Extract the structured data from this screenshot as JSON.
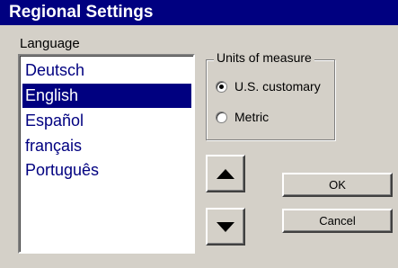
{
  "window": {
    "title": "Regional Settings"
  },
  "language": {
    "label": "Language",
    "items": [
      "Deutsch",
      "English",
      "Español",
      "français",
      "Português"
    ],
    "selected": "English"
  },
  "units": {
    "group_label": "Units of measure",
    "options": [
      {
        "label": "U.S. customary",
        "checked": true
      },
      {
        "label": "Metric",
        "checked": false
      }
    ]
  },
  "buttons": {
    "ok": "OK",
    "cancel": "Cancel"
  },
  "icons": {
    "move_up": "triangle-up-icon",
    "move_down": "triangle-down-icon"
  },
  "colors": {
    "titlebar": "#000080",
    "selection": "#000080",
    "face": "#d4d0c8"
  }
}
